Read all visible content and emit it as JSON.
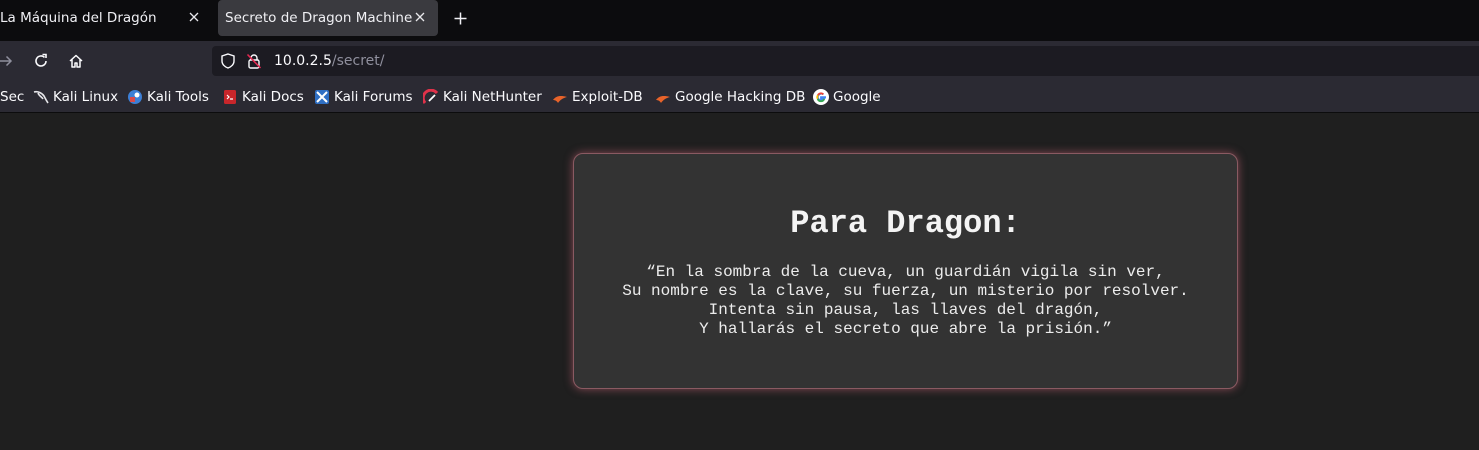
{
  "tabs": [
    {
      "title": "La Máquina del Dragón",
      "active": false
    },
    {
      "title": "Secreto de Dragon Machine",
      "active": true
    }
  ],
  "toolbar": {
    "icons": {
      "forward": "arrow-right-icon",
      "reload": "reload-icon",
      "home": "home-icon",
      "new_tab": "plus-icon",
      "close": "close-icon"
    }
  },
  "urlbar": {
    "host": "10.0.2.5",
    "path": "/secret/",
    "icons": [
      "shield-icon",
      "insecure-lock-icon"
    ]
  },
  "bookmarks": [
    {
      "label": "Sec"
    },
    {
      "label": "Kali Linux",
      "icon": "kali-dragon-icon"
    },
    {
      "label": "Kali Tools",
      "icon": "kali-tools-icon"
    },
    {
      "label": "Kali Docs",
      "icon": "kali-docs-icon"
    },
    {
      "label": "Kali Forums",
      "icon": "kali-forums-icon"
    },
    {
      "label": "Kali NetHunter",
      "icon": "nethunter-icon"
    },
    {
      "label": "Exploit-DB",
      "icon": "exploit-db-icon"
    },
    {
      "label": "Google Hacking DB",
      "icon": "ghdb-icon"
    },
    {
      "label": "Google",
      "icon": "google-icon"
    }
  ],
  "page": {
    "heading": "Para Dragon:",
    "poem": [
      "“En la sombra de la cueva, un guardián vigila sin ver,",
      "Su nombre es la clave, su fuerza, un misterio por resolver.",
      "Intenta sin pausa, las llaves del dragón,",
      "Y hallarás el secreto que abre la prisión.”"
    ]
  },
  "colors": {
    "background": "#1f1f1f",
    "card": "#333333",
    "card_glow": "#dc6e82",
    "chrome": "#2b2a33",
    "tabstrip": "#0c0c0e"
  }
}
